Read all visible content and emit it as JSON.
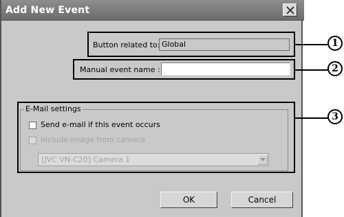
{
  "dialog": {
    "title": "Add New Event"
  },
  "button_related": {
    "label": "Button related to:",
    "value": "Global"
  },
  "manual_event": {
    "label": "Manual event name :",
    "value": ""
  },
  "email_settings": {
    "legend": "E-Mail settings",
    "send_email_label": "Send e-mail if this event occurs",
    "include_image_label": "Include image from camera",
    "camera_select_value": "[JVC VN-C20] Camera 1"
  },
  "buttons": {
    "ok": "OK",
    "cancel": "Cancel"
  },
  "callouts": [
    "1",
    "2",
    "3"
  ],
  "colors": {
    "title_bar": "#7a7a7a",
    "dialog_bg": "#c9c9c9"
  }
}
